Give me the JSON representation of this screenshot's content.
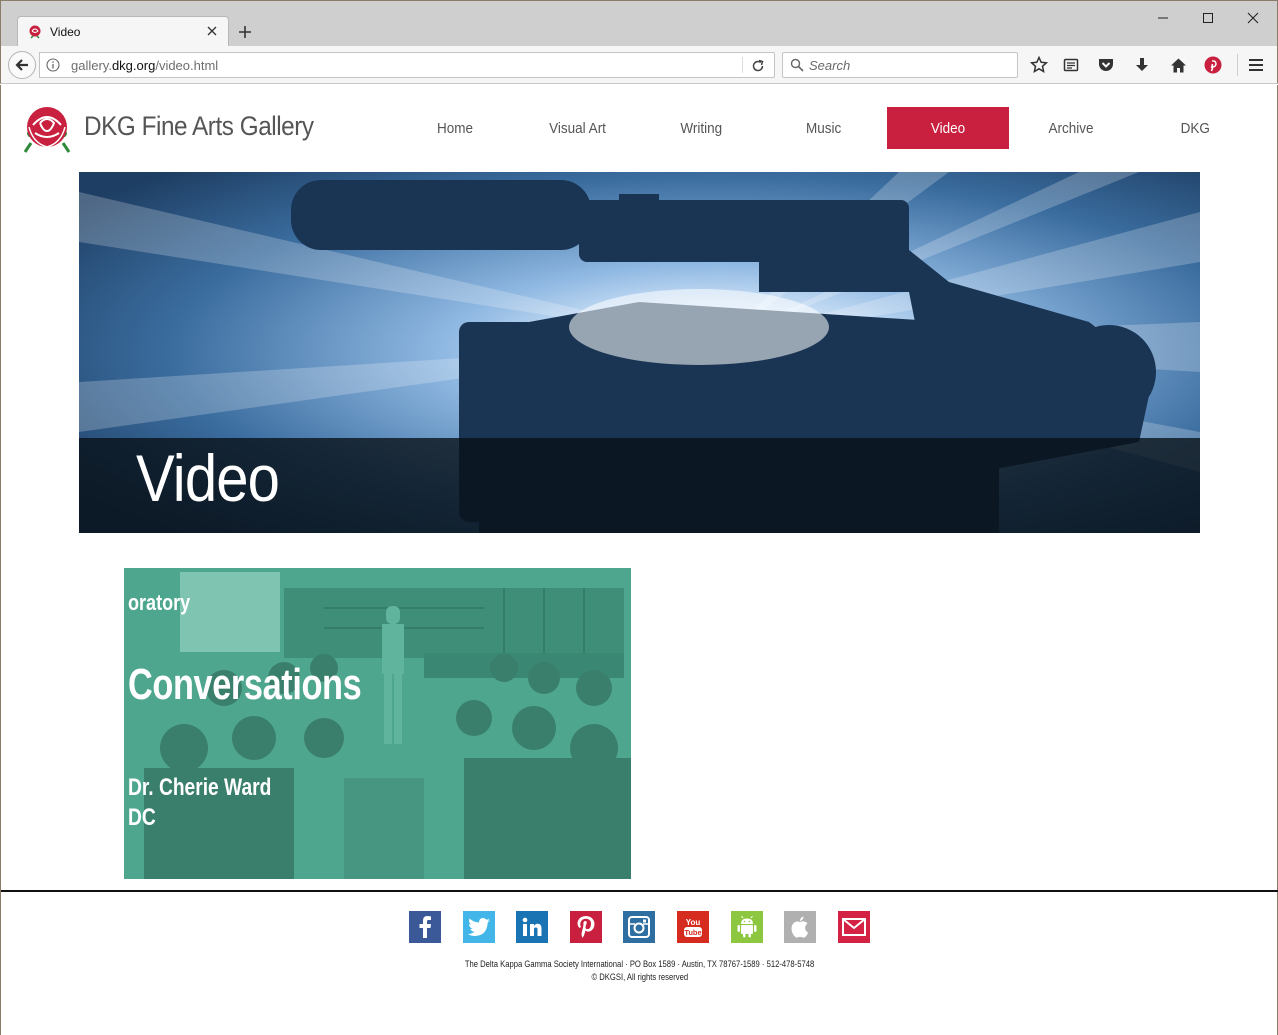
{
  "browser": {
    "tab_title": "Video",
    "url_host_prefix": "gallery.",
    "url_host_domain": "dkg.org",
    "url_path": "/video.html",
    "search_placeholder": "Search"
  },
  "site": {
    "title": "DKG Fine Arts Gallery",
    "nav": [
      "Home",
      "Visual Art",
      "Writing",
      "Music",
      "Video",
      "Archive",
      "DKG"
    ],
    "active_nav": "Video",
    "accent_color": "#c8203e"
  },
  "hero": {
    "title": "Video"
  },
  "video_card": {
    "category": "oratory",
    "title": "Conversations",
    "author": "Dr. Cherie Ward",
    "location": "DC"
  },
  "footer": {
    "social": [
      {
        "name": "facebook",
        "color": "#3b5998"
      },
      {
        "name": "twitter",
        "color": "#42b6e8"
      },
      {
        "name": "linkedin",
        "color": "#1a74b3"
      },
      {
        "name": "pinterest",
        "color": "#c8203e"
      },
      {
        "name": "instagram",
        "color": "#2f6ea1"
      },
      {
        "name": "youtube",
        "color": "#d62b1f"
      },
      {
        "name": "android",
        "color": "#8dc63f"
      },
      {
        "name": "apple",
        "color": "#b0b0b0"
      },
      {
        "name": "email",
        "color": "#d32244"
      }
    ],
    "address_line": "The Delta Kappa Gamma Society International · PO Box 1589 · Austin, TX 78767-1589 · 512-478-5748",
    "copyright_line": "© DKGSI, All rights reserved"
  }
}
